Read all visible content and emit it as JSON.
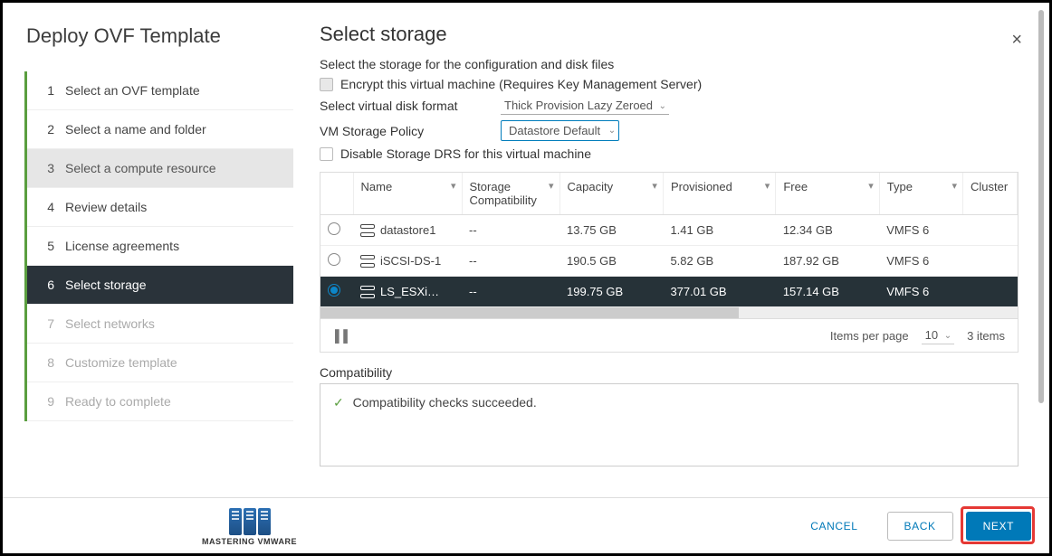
{
  "wizard_title": "Deploy OVF Template",
  "close_label": "×",
  "steps": [
    {
      "num": "1",
      "label": "Select an OVF template",
      "state": "done"
    },
    {
      "num": "2",
      "label": "Select a name and folder",
      "state": "done"
    },
    {
      "num": "3",
      "label": "Select a compute resource",
      "state": "pseudo-active"
    },
    {
      "num": "4",
      "label": "Review details",
      "state": "done"
    },
    {
      "num": "5",
      "label": "License agreements",
      "state": "done"
    },
    {
      "num": "6",
      "label": "Select storage",
      "state": "current"
    },
    {
      "num": "7",
      "label": "Select networks",
      "state": "future"
    },
    {
      "num": "8",
      "label": "Customize template",
      "state": "future"
    },
    {
      "num": "9",
      "label": "Ready to complete",
      "state": "future"
    }
  ],
  "page_title": "Select storage",
  "subtitle": "Select the storage for the configuration and disk files",
  "encrypt_label": "Encrypt this virtual machine (Requires Key Management Server)",
  "disk_format_label": "Select virtual disk format",
  "disk_format_value": "Thick Provision Lazy Zeroed",
  "vm_policy_label": "VM Storage Policy",
  "vm_policy_value": "Datastore Default",
  "disable_drs_label": "Disable Storage DRS for this virtual machine",
  "table": {
    "headers": {
      "name": "Name",
      "compat": "Storage Compatibility",
      "capacity": "Capacity",
      "provisioned": "Provisioned",
      "free": "Free",
      "type": "Type",
      "cluster": "Cluster"
    },
    "rows": [
      {
        "selected": false,
        "name": "datastore1",
        "compat": "--",
        "capacity": "13.75 GB",
        "provisioned": "1.41 GB",
        "free": "12.34 GB",
        "type": "VMFS 6"
      },
      {
        "selected": false,
        "name": "iSCSI-DS-1",
        "compat": "--",
        "capacity": "190.5 GB",
        "provisioned": "5.82 GB",
        "free": "187.92 GB",
        "type": "VMFS 6"
      },
      {
        "selected": true,
        "name": "LS_ESXi…",
        "compat": "--",
        "capacity": "199.75 GB",
        "provisioned": "377.01 GB",
        "free": "157.14 GB",
        "type": "VMFS 6"
      }
    ]
  },
  "pager": {
    "items_per_page_label": "Items per page",
    "items_per_page_value": "10",
    "total": "3 items"
  },
  "compat_label": "Compatibility",
  "compat_msg": "Compatibility checks succeeded.",
  "buttons": {
    "cancel": "CANCEL",
    "back": "BACK",
    "next": "NEXT"
  },
  "logo_caption": "MASTERING VMWARE"
}
